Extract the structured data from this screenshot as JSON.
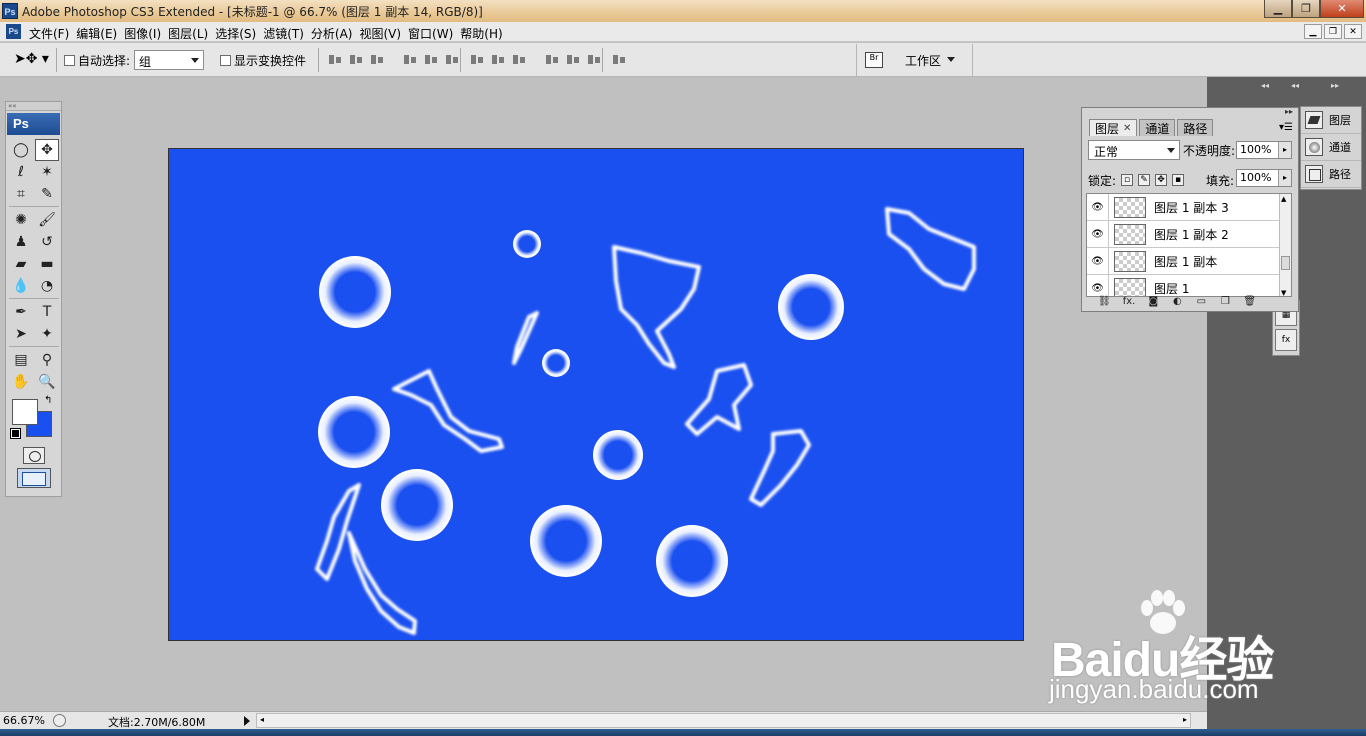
{
  "window": {
    "app_icon": "Ps",
    "title": "Adobe Photoshop CS3 Extended - [未标题-1 @ 66.7% (图层 1 副本 14, RGB/8)]"
  },
  "menu": {
    "ps_icon": "Ps",
    "items": [
      "文件(F)",
      "编辑(E)",
      "图像(I)",
      "图层(L)",
      "选择(S)",
      "滤镜(T)",
      "分析(A)",
      "视图(V)",
      "窗口(W)",
      "帮助(H)"
    ]
  },
  "options": {
    "auto_select_label": "自动选择:",
    "auto_select_value": "组",
    "show_transform_label": "显示变换控件",
    "workspace_label": "工作区"
  },
  "toolbox": {
    "logo": "Ps",
    "foreground_color": "#ffffff",
    "background_color": "#1a4ff0"
  },
  "canvas": {
    "background_color": "#1a4ff0"
  },
  "layers_panel": {
    "tabs": [
      "图层",
      "通道",
      "路径"
    ],
    "blend_mode": "正常",
    "opacity_label": "不透明度:",
    "opacity_value": "100%",
    "lock_label": "锁定:",
    "fill_label": "填充:",
    "fill_value": "100%",
    "layers": [
      "图层 1 副本 3",
      "图层 1 副本 2",
      "图层 1 副本",
      "图层 1"
    ]
  },
  "dock": {
    "items": [
      "图层",
      "通道",
      "路径"
    ]
  },
  "status": {
    "zoom": "66.67%",
    "doc_size": "文档:2.70M/6.80M"
  },
  "watermark": {
    "brand": "Baidu经验",
    "url": "jingyan.baidu.com"
  }
}
